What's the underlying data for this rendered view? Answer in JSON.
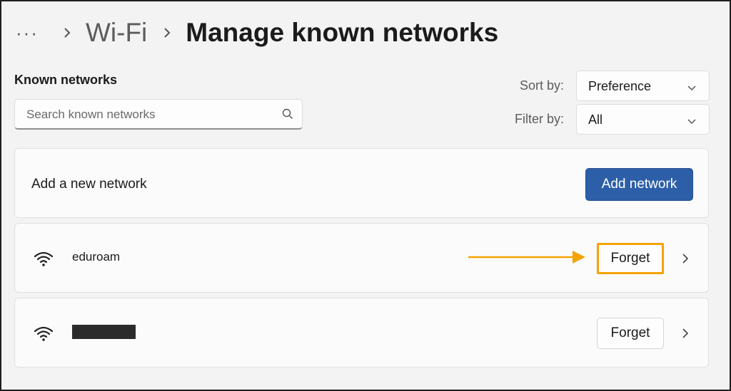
{
  "header": {
    "more": "···",
    "parent": "Wi-Fi",
    "title": "Manage known networks"
  },
  "known_networks": {
    "label": "Known networks",
    "search_placeholder": "Search known networks"
  },
  "sort": {
    "label": "Sort by:",
    "value": "Preference"
  },
  "filter": {
    "label": "Filter by:",
    "value": "All"
  },
  "add_network": {
    "label": "Add a new network",
    "button": "Add network"
  },
  "networks": [
    {
      "name": "eduroam",
      "forget_label": "Forget",
      "highlighted": true
    },
    {
      "name": "",
      "redacted": true,
      "forget_label": "Forget",
      "highlighted": false
    }
  ],
  "colors": {
    "accent": "#2d5fa8",
    "highlight": "#f5a300"
  },
  "icons": [
    "search-icon",
    "chevron-down-icon",
    "chevron-right-icon",
    "wifi-icon",
    "arrow-icon"
  ]
}
